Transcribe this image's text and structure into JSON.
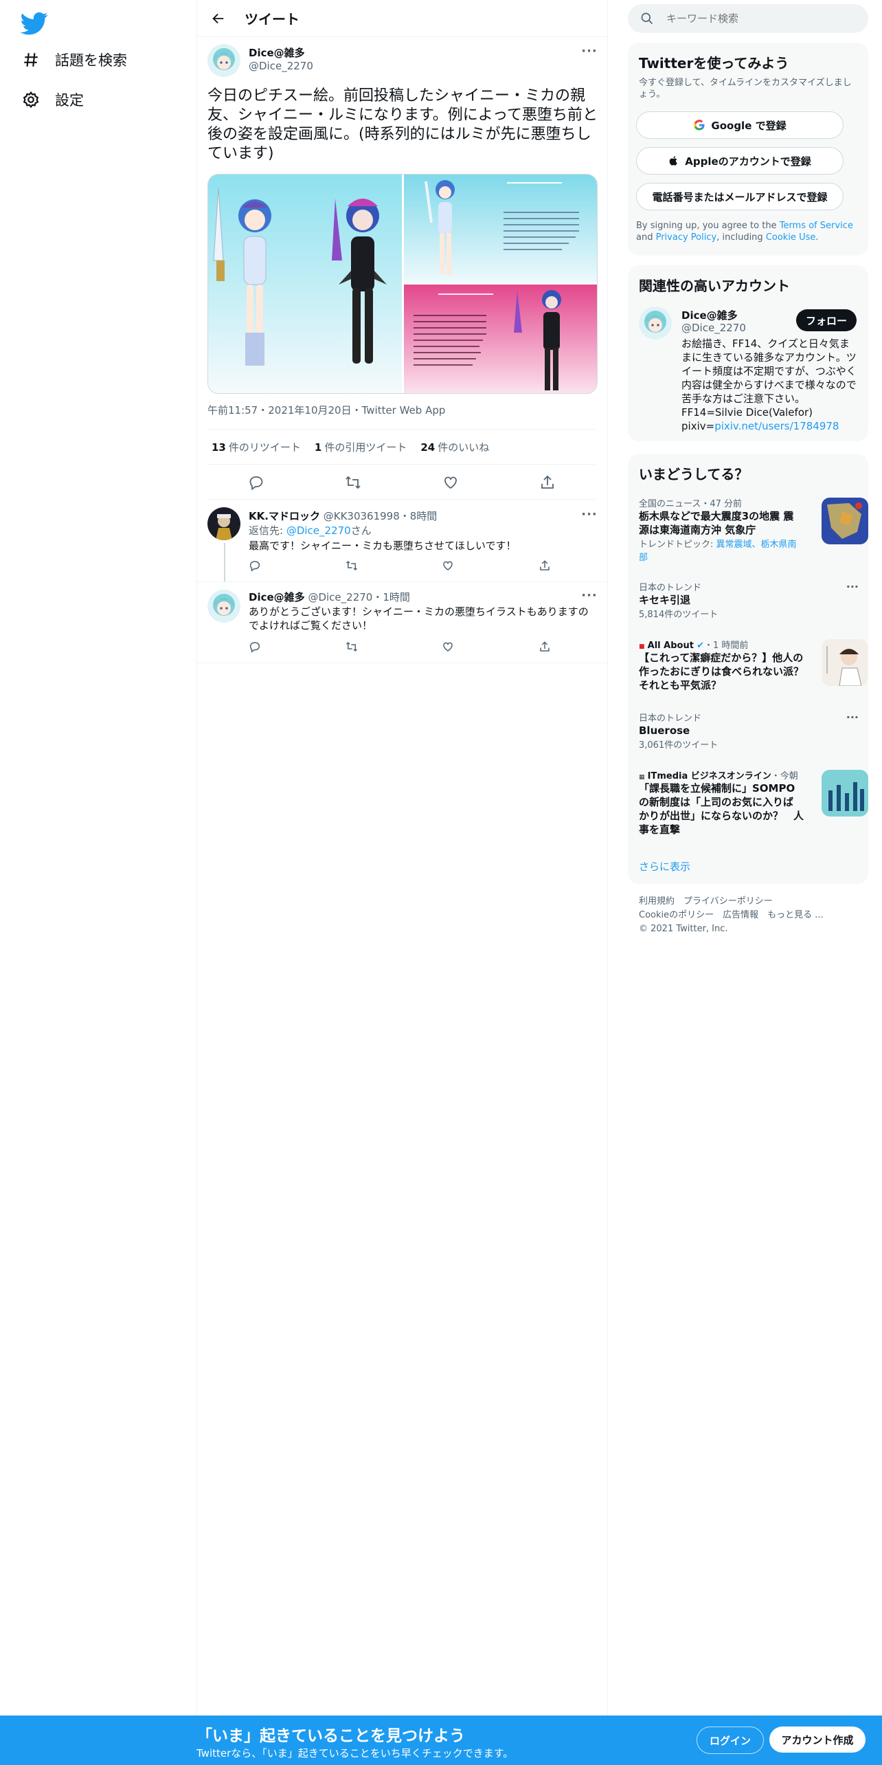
{
  "nav": {
    "logo": "twitter-bird-icon",
    "items": [
      {
        "label": "話題を検索",
        "icon": "hashtag-icon"
      },
      {
        "label": "設定",
        "icon": "gear-icon"
      }
    ]
  },
  "header": {
    "title": "ツイート",
    "back_icon": "arrow-left-icon"
  },
  "tweet": {
    "name": "Dice@雑多",
    "handle": "@Dice_2270",
    "text": "今日のピチスー絵。前回投稿したシャイニー・ミカの親友、シャイニー・ルミになります。例によって悪堕ち前と後の姿を設定画風に。(時系列的にはルミが先に悪堕ちしています)",
    "meta": "午前11:57・2021年10月20日・Twitter Web App",
    "stats": [
      {
        "count": "13",
        "label": "件のリツイート"
      },
      {
        "count": "1",
        "label": "件の引用ツイート"
      },
      {
        "count": "24",
        "label": "件のいいね"
      }
    ]
  },
  "replies": [
    {
      "name": "KK.マドロック",
      "handle": "@KK30361998",
      "time": "・8時間",
      "reply_to_prefix": "返信先: ",
      "reply_to": "@Dice_2270",
      "reply_to_suffix": "さん",
      "text": "最高です！シャイニー・ミカも悪堕ちさせてほしいです！"
    },
    {
      "name": "Dice@雑多",
      "handle": "@Dice_2270",
      "time": "・1時間",
      "text": "ありがとうございます！シャイニー・ミカの悪堕ちイラストもありますのでよければご覧ください！"
    }
  ],
  "search": {
    "placeholder": "キーワード検索"
  },
  "signup": {
    "title": "Twitterを使ってみよう",
    "subtitle": "今すぐ登録して、タイムラインをカスタマイズしましょう。",
    "google": "Google で登録",
    "apple": "Appleのアカウントで登録",
    "phone": "電話番号またはメールアドレスで登録",
    "terms_prefix": "By signing up, you agree to the ",
    "terms_tos": "Terms of Service",
    "terms_and": " and ",
    "terms_privacy": "Privacy Policy",
    "terms_including": ", including ",
    "terms_cookie": "Cookie Use",
    "terms_end": "."
  },
  "related": {
    "title": "関連性の高いアカウント",
    "name": "Dice@雑多",
    "handle": "@Dice_2270",
    "follow": "フォロー",
    "bio": "お絵描き、FF14、クイズと日々気ままに生きている雑多なアカウント。ツイート頻度は不定期ですが、つぶやく内容は健全からすけべまで様々なので苦手な方はご注意下さい。",
    "bio2": "FF14=Silvie Dice(Valefor)",
    "bio3_prefix": "pixiv=",
    "bio3_link": "pixiv.net/users/1784978"
  },
  "trends": {
    "title": "いまどうしてる？",
    "items": [
      {
        "category": "全国のニュース・47 分前",
        "title": "栃木県などで最大震度3の地震 震源は東海道南方沖 気象庁",
        "topic_prefix": "トレンドトピック: ",
        "topic_links": "異常震域、栃木県南部"
      },
      {
        "category": "日本のトレンド",
        "title": "キセキ引退",
        "count": "5,814件のツイート"
      },
      {
        "source": "All About",
        "category": "・1 時間前",
        "title": "【これって潔癖症だから？】他人の作ったおにぎりは食べられない派？それとも平気派？"
      },
      {
        "category": "日本のトレンド",
        "title": "Bluerose",
        "count": "3,061件のツイート"
      },
      {
        "source": "ITmedia ビジネスオンライン",
        "category": "・今朝",
        "title": "「課長職を立候補制に」SOMPOの新制度は「上司のお気に入りばかりが出世」にならないのか？　人事を直撃"
      }
    ],
    "more": "さらに表示"
  },
  "footer": {
    "line1": "利用規約　プライバシーポリシー",
    "line2": "Cookieのポリシー　広告情報　もっと見る ...",
    "line3": "© 2021 Twitter, Inc."
  },
  "bottombar": {
    "headline": "「いま」起きていることを見つけよう",
    "sub": "Twitterなら、「いま」起きていることをいち早くチェックできます。",
    "login": "ログイン",
    "signup": "アカウント作成"
  },
  "colors": {
    "accent": "#1d9bf0",
    "text": "#0f1419",
    "muted": "#536471",
    "border": "#eff3f4"
  }
}
